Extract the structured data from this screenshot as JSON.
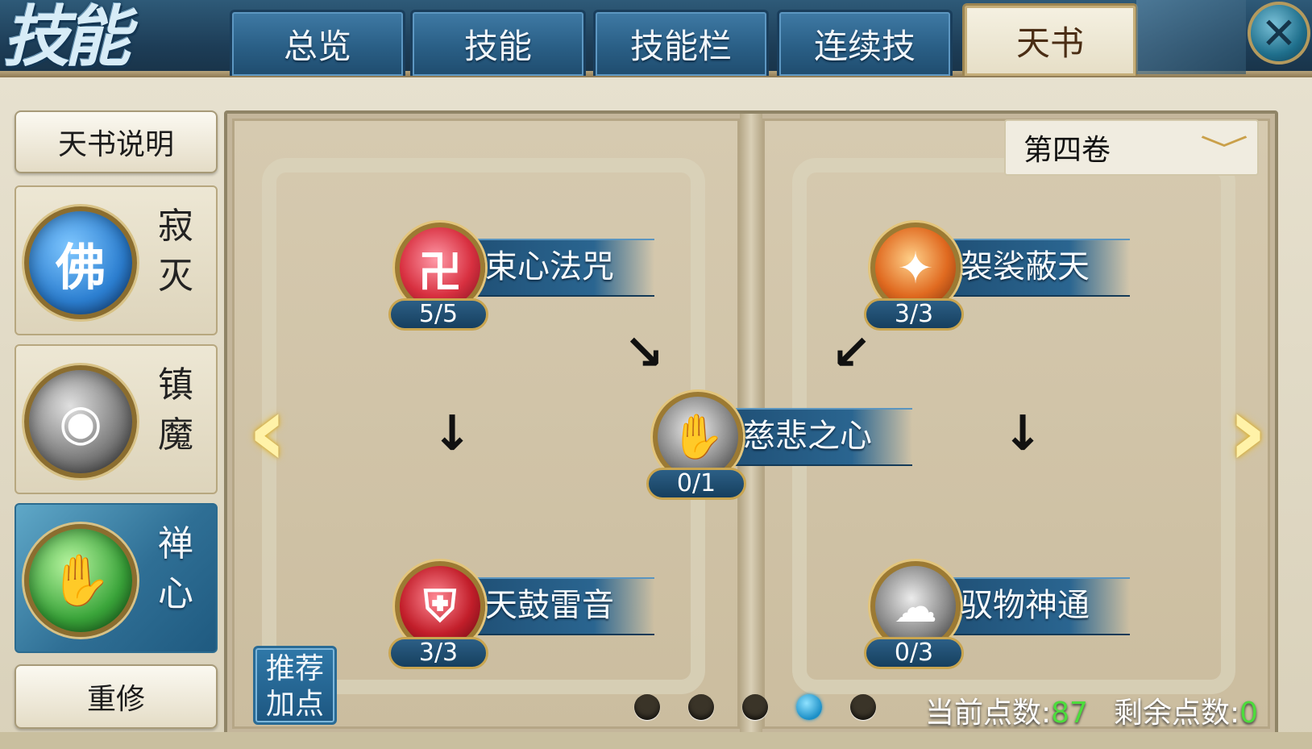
{
  "header": {
    "title": "技能",
    "tabs": [
      {
        "label": "总览",
        "active": false
      },
      {
        "label": "技能",
        "active": false
      },
      {
        "label": "技能栏",
        "active": false
      },
      {
        "label": "连续技",
        "active": false
      },
      {
        "label": "天书",
        "active": true
      }
    ],
    "close_icon": "close-x-icon"
  },
  "sidebar": {
    "info_button": "天书说明",
    "sections": [
      {
        "name": "寂灭",
        "icon": "buddha-orb-icon",
        "color": "#2c7fd1",
        "active": false
      },
      {
        "name": "镇魔",
        "icon": "demon-orb-icon",
        "color": "#7a7a7a",
        "active": false
      },
      {
        "name": "禅心",
        "icon": "zen-orb-icon",
        "color": "#3aa53a",
        "active": true
      }
    ],
    "reset_button": "重修"
  },
  "book": {
    "volume": "第四卷",
    "skills": [
      {
        "name": "束心法咒",
        "level": "5/5",
        "icon": "swastika-icon",
        "color": "#d83040"
      },
      {
        "name": "袈裟蔽天",
        "level": "3/3",
        "icon": "robe-icon",
        "color": "#e06a20"
      },
      {
        "name": "慈悲之心",
        "level": "0/1",
        "icon": "palm-icon",
        "color": "#8a8a8a"
      },
      {
        "name": "天鼓雷音",
        "level": "3/3",
        "icon": "shield-icon",
        "color": "#c21e2a"
      },
      {
        "name": "驭物神通",
        "level": "0/3",
        "icon": "spirit-icon",
        "color": "#8a8a8a"
      }
    ],
    "recommend_button": "推荐加点",
    "pages": {
      "count": 5,
      "current": 4
    },
    "current_points_label": "当前点数:",
    "current_points": "87",
    "remaining_points_label": "剩余点数:",
    "remaining_points": "0"
  }
}
